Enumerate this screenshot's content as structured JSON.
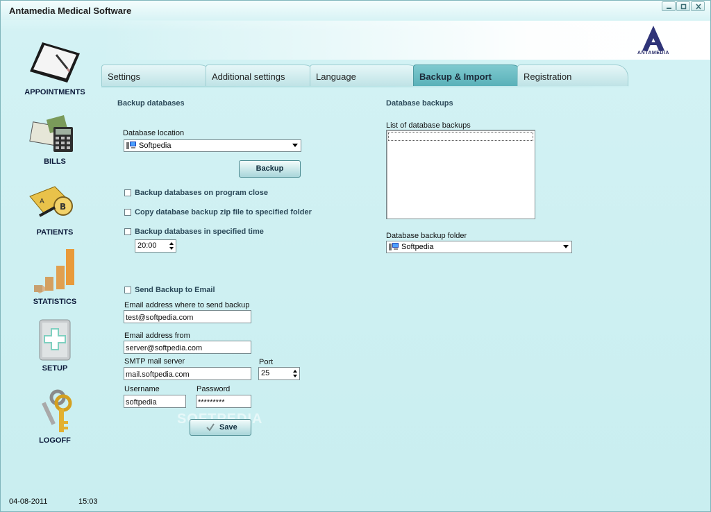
{
  "window": {
    "title": "Antamedia Medical Software"
  },
  "logo": {
    "text": "ANTAMEDIA"
  },
  "sidebar": {
    "items": [
      {
        "label": "APPOINTMENTS",
        "icon": "clipboard-pen-icon"
      },
      {
        "label": "BILLS",
        "icon": "bills-calculator-icon"
      },
      {
        "label": "PATIENTS",
        "icon": "patient-folders-magnifier-icon"
      },
      {
        "label": "STATISTICS",
        "icon": "bar-chart-icon"
      },
      {
        "label": "SETUP",
        "icon": "medical-cabinet-icon"
      },
      {
        "label": "LOGOFF",
        "icon": "keys-icon"
      }
    ]
  },
  "tabs": [
    {
      "label": "Settings",
      "active": false
    },
    {
      "label": "Additional settings",
      "active": false
    },
    {
      "label": "Language",
      "active": false
    },
    {
      "label": "Backup & Import",
      "active": true
    },
    {
      "label": "Registration",
      "active": false
    }
  ],
  "backup": {
    "title": "Backup databases",
    "db_location_label": "Database location",
    "db_location_value": "Softpedia",
    "backup_button": "Backup",
    "chk_on_close": "Backup databases on program close",
    "chk_copy_zip": "Copy database backup zip file to specified folder",
    "chk_specified_time": "Backup databases in specified time",
    "time_value": "20:00"
  },
  "email": {
    "chk_send": "Send Backup to Email",
    "to_label": "Email address where to send backup",
    "to_value": "test@softpedia.com",
    "from_label": "Email address from",
    "from_value": "server@softpedia.com",
    "smtp_label": "SMTP mail server",
    "smtp_value": "mail.softpedia.com",
    "port_label": "Port",
    "port_value": "25",
    "username_label": "Username",
    "username_value": "softpedia",
    "password_label": "Password",
    "password_value": "*********",
    "save_button": "Save"
  },
  "db_backups": {
    "title": "Database backups",
    "list_label": "List of database backups",
    "folder_label": "Database backup folder",
    "folder_value": "Softpedia"
  },
  "watermark": "SOFTPEDIA",
  "status": {
    "date": "04-08-2011",
    "time": "15:03"
  }
}
